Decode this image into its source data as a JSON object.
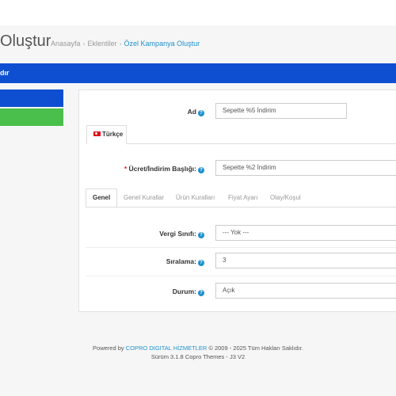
{
  "header": {
    "title": "Oluştur",
    "breadcrumb": [
      "Anasayfa",
      "Eklentiler",
      "Özel Kampanya Oluştur"
    ]
  },
  "panel": {
    "heading_text": "dır"
  },
  "form": {
    "name_label": "Ad",
    "name_value": "Sepette %5 İndirim",
    "language_tab": "Türkçe",
    "title_label": "Ücret/İndirim Başlığı:",
    "title_value": "Sepette %2 İndirim",
    "tabs": [
      "Genel",
      "Genel Kurallar",
      "Ürün Kuralları",
      "Fiyat Ayarı",
      "Olay/Koşul"
    ],
    "tax_label": "Vergi Sınıfı:",
    "tax_value": "--- Yok ---",
    "order_label": "Sıralama:",
    "order_value": "3",
    "status_label": "Durum:",
    "status_value": "Açık"
  },
  "footer": {
    "powered_by": "Powered by",
    "brand": "COPRO DIGITAL HİZMETLER",
    "copyright": "© 2009 - 2025 Tüm Hakları Saklıdır.",
    "version": "Sürüm 3.1.8 Copro Themes - J3 V2"
  },
  "colors": {
    "accent_blue": "#0e4fd1",
    "success_green": "#4bbf4b",
    "link_blue": "#1e91cf"
  }
}
